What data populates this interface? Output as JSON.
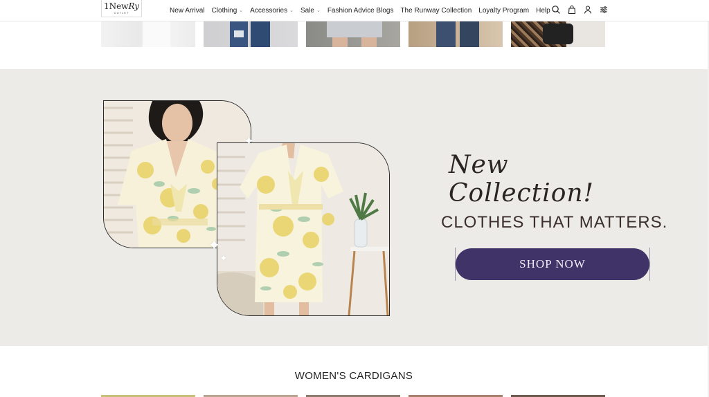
{
  "logo": {
    "line1_prefix": "1New",
    "line1_script": "Ry",
    "line2": "OUTLET"
  },
  "nav": [
    {
      "label": "New Arrival",
      "has_dropdown": false
    },
    {
      "label": "Clothing",
      "has_dropdown": true
    },
    {
      "label": "Accessories",
      "has_dropdown": true
    },
    {
      "label": "Sale",
      "has_dropdown": true
    },
    {
      "label": "Fashion Advice Blogs",
      "has_dropdown": false
    },
    {
      "label": "The Runway Collection",
      "has_dropdown": false
    },
    {
      "label": "Loyalty Program",
      "has_dropdown": false
    },
    {
      "label": "Help",
      "has_dropdown": true
    }
  ],
  "header_icons": [
    "search-icon",
    "bag-icon",
    "account-icon",
    "filter-icon"
  ],
  "banner": {
    "script_title": "New Collection!",
    "headline": "CLOTHES THAT MATTERS.",
    "button_label": "SHOP NOW",
    "button_color": "#3f3368",
    "background": "#ecebe8"
  },
  "section": {
    "title": "WOMEN'S CARDIGANS"
  }
}
